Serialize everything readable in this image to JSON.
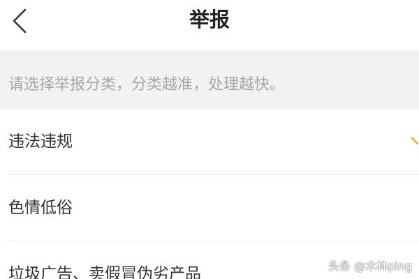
{
  "header": {
    "title": "举报",
    "back_icon": "chevron-left-icon"
  },
  "notice": {
    "text": "请选择举报分类，分类越准，处理越快。"
  },
  "categories": [
    {
      "label": "违法违规",
      "icon": "chevron-right-icon"
    },
    {
      "label": "色情低俗"
    },
    {
      "label": "垃圾广告、卖假冒伪劣产品"
    }
  ],
  "watermark": {
    "text": "头条 @木林ping"
  },
  "colors": {
    "accent": "#f5a623",
    "background": "#ffffff",
    "notice_background": "#f2f2f2",
    "notice_text": "#a6a6a6",
    "text": "#333333"
  }
}
